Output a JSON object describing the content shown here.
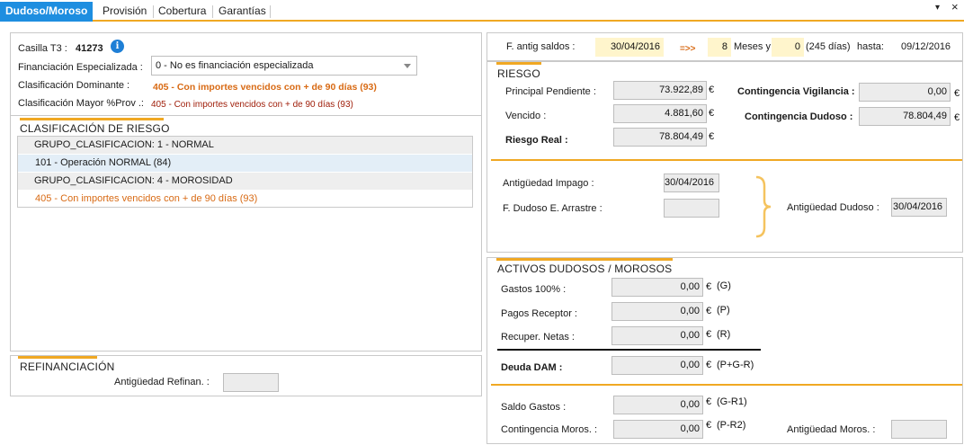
{
  "tabs": [
    {
      "label": "Dudoso/Moroso"
    },
    {
      "label": "Provisión"
    },
    {
      "label": "Cobertura"
    },
    {
      "label": "Garantías"
    }
  ],
  "window": {
    "menu_glyph": "▾",
    "close_glyph": "×"
  },
  "header": {
    "casilla_label": "Casilla T3 :",
    "casilla_value": "41273",
    "fin_label": "Financiación Especializada :",
    "fin_value": "0 - No es financiación especializada",
    "dom_label": "Clasificación Dominante :",
    "dom_value": "405 - Con importes vencidos con + de 90 días (93)",
    "mayor_label": "Clasificación Mayor %Prov .:",
    "mayor_value": "405 - Con importes vencidos con + de 90 días (93)"
  },
  "clasificacion": {
    "title": "CLASIFICACIÓN DE RIESGO",
    "rows": [
      {
        "text": "GRUPO_CLASIFICACION: 1 - NORMAL"
      },
      {
        "text": "101 - Operación NORMAL (84)"
      },
      {
        "text": "GRUPO_CLASIFICACION: 4 - MOROSIDAD"
      },
      {
        "text": "405 - Con importes vencidos con + de 90 días (93)"
      }
    ]
  },
  "refinanciacion": {
    "title": "REFINANCIACIÓN",
    "antiguedad_label": "Antigüedad Refinan. :",
    "antiguedad_value": ""
  },
  "saldos": {
    "label": "F. antig saldos :",
    "date": "30/04/2016",
    "arrow": "=>>",
    "months": "8",
    "months_label": "Meses y",
    "days": "0",
    "days_label": "(245 días)",
    "hasta_label": "hasta:",
    "hasta_value": "09/12/2016"
  },
  "riesgo": {
    "title": "RIESGO",
    "principal_label": "Principal Pendiente :",
    "principal_value": "73.922,89",
    "vencido_label": "Vencido :",
    "vencido_value": "4.881,60",
    "real_label": "Riesgo Real :",
    "real_value": "78.804,49",
    "vigilancia_label": "Contingencia Vigilancia :",
    "vigilancia_value": "0,00",
    "dudoso_label": "Contingencia Dudoso :",
    "dudoso_value": "78.804,49",
    "currency": "€"
  },
  "antiguedad": {
    "impago_label": "Antigüedad Impago :",
    "impago_value": "30/04/2016",
    "arrastre_label": "F. Dudoso E. Arrastre :",
    "arrastre_value": "",
    "dudoso_label": "Antigüedad Dudoso :",
    "dudoso_value": "30/04/2016"
  },
  "activos": {
    "title": "ACTIVOS DUDOSOS / MOROSOS",
    "gastos_label": "Gastos 100% :",
    "gastos_value": "0,00",
    "gastos_code": "(G)",
    "pagos_label": "Pagos Receptor :",
    "pagos_value": "0,00",
    "pagos_code": "(P)",
    "recuper_label": "Recuper. Netas :",
    "recuper_value": "0,00",
    "recuper_code": "(R)",
    "deuda_label": "Deuda DAM :",
    "deuda_value": "0,00",
    "deuda_code": "(P+G-R)",
    "saldo_label": "Saldo Gastos :",
    "saldo_value": "0,00",
    "saldo_code": "(G-R1)",
    "contmoros_label": "Contingencia Moros. :",
    "contmoros_value": "0,00",
    "contmoros_code": "(P-R2)",
    "antmoros_label": "Antigüedad Moros. :",
    "antmoros_value": ""
  },
  "colors": {
    "accent": "#f0a823",
    "tab_active": "#1e8ee0",
    "orange_text": "#d86a14"
  }
}
